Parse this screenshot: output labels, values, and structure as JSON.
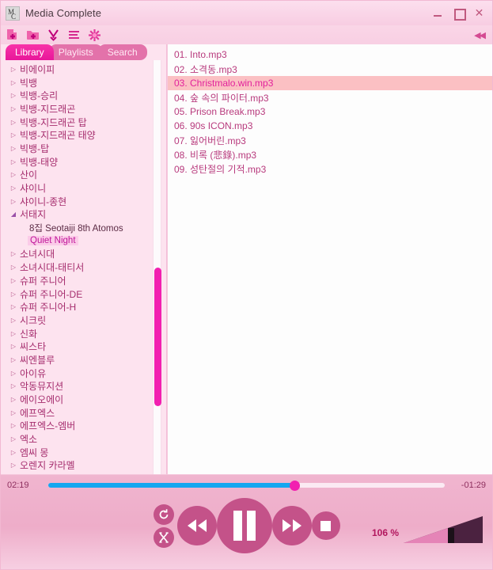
{
  "window": {
    "title": "Media Complete",
    "icon": "mc-logo-icon",
    "minimize_label": "",
    "maximize_label": "",
    "close_label": "✕"
  },
  "toolbar": {
    "icons": [
      {
        "name": "add-file-icon",
        "label": ""
      },
      {
        "name": "add-folder-icon",
        "label": ""
      },
      {
        "name": "import-download-icon",
        "label": ""
      },
      {
        "name": "playlist-lines-icon",
        "label": ""
      },
      {
        "name": "settings-star-icon",
        "label": ""
      }
    ],
    "collapse_label": "◀◀"
  },
  "tabs": [
    {
      "label": "Library",
      "active": true
    },
    {
      "label": "Playlists",
      "active": false
    },
    {
      "label": "Search",
      "active": false
    }
  ],
  "sidebar": {
    "items": [
      {
        "label": "비에이피",
        "type": "collapsed",
        "level": 0
      },
      {
        "label": "빅뱅",
        "type": "collapsed",
        "level": 0
      },
      {
        "label": "빅뱅-승리",
        "type": "collapsed",
        "level": 0
      },
      {
        "label": "빅뱅-지드래곤",
        "type": "collapsed",
        "level": 0
      },
      {
        "label": "빅뱅-지드래곤 탑",
        "type": "collapsed",
        "level": 0
      },
      {
        "label": "빅뱅-지드래곤 태양",
        "type": "collapsed",
        "level": 0
      },
      {
        "label": "빅뱅-탑",
        "type": "collapsed",
        "level": 0
      },
      {
        "label": "빅뱅-태양",
        "type": "collapsed",
        "level": 0
      },
      {
        "label": "산이",
        "type": "collapsed",
        "level": 0
      },
      {
        "label": "샤이니",
        "type": "collapsed",
        "level": 0
      },
      {
        "label": "샤이니-종현",
        "type": "collapsed",
        "level": 0
      },
      {
        "label": "서태지",
        "type": "expanded",
        "level": 0
      },
      {
        "label": "8집 Seotaiji 8th Atomos",
        "type": "child",
        "level": 1
      },
      {
        "label": "Quiet Night",
        "type": "child-selected",
        "level": 1
      },
      {
        "label": "소녀시대",
        "type": "collapsed",
        "level": 0
      },
      {
        "label": "소녀시대-태티서",
        "type": "collapsed",
        "level": 0
      },
      {
        "label": "슈퍼 주니어",
        "type": "collapsed",
        "level": 0
      },
      {
        "label": "슈퍼 주니어-DE",
        "type": "collapsed",
        "level": 0
      },
      {
        "label": "슈퍼 주니어-H",
        "type": "collapsed",
        "level": 0
      },
      {
        "label": "시크릿",
        "type": "collapsed",
        "level": 0
      },
      {
        "label": "신화",
        "type": "collapsed",
        "level": 0
      },
      {
        "label": "씨스타",
        "type": "collapsed",
        "level": 0
      },
      {
        "label": "씨엔블루",
        "type": "collapsed",
        "level": 0
      },
      {
        "label": "아이유",
        "type": "collapsed",
        "level": 0
      },
      {
        "label": "악동뮤지션",
        "type": "collapsed",
        "level": 0
      },
      {
        "label": "에이오에이",
        "type": "collapsed",
        "level": 0
      },
      {
        "label": "에프엑스",
        "type": "collapsed",
        "level": 0
      },
      {
        "label": "에프엑스-엠버",
        "type": "collapsed",
        "level": 0
      },
      {
        "label": "엑소",
        "type": "collapsed",
        "level": 0
      },
      {
        "label": "엠씨 몽",
        "type": "collapsed",
        "level": 0
      },
      {
        "label": "오렌지 카라멜",
        "type": "collapsed",
        "level": 0
      }
    ],
    "collapsed_arrow": "▷",
    "expanded_arrow": "◢"
  },
  "tracklist": [
    {
      "label": "01. Into.mp3",
      "selected": false
    },
    {
      "label": "02. 소격동.mp3",
      "selected": false
    },
    {
      "label": "03. Christmalo.win.mp3",
      "selected": true
    },
    {
      "label": "04. 숲 속의 파이터.mp3",
      "selected": false
    },
    {
      "label": "05. Prison Break.mp3",
      "selected": false
    },
    {
      "label": "06. 90s ICON.mp3",
      "selected": false
    },
    {
      "label": "07. 잃어버린.mp3",
      "selected": false
    },
    {
      "label": "08. 비록 (悲錄).mp3",
      "selected": false
    },
    {
      "label": "09. 성탄절의 기적.mp3",
      "selected": false
    }
  ],
  "player": {
    "elapsed": "02:19",
    "remaining": "-01:29",
    "progress_percent": 62,
    "repeat_label": "↻",
    "shuffle_label": "⤫",
    "rewind_label": "◀◀",
    "pause_label": "❚❚",
    "forward_label": "▶▶",
    "stop_label": "■",
    "volume_label": "106 %",
    "volume_percent": 56
  },
  "colors": {
    "accent": "#f21fb0",
    "button": "#c45289",
    "seek": "#15a7f0",
    "selection": "#fbc0c3",
    "background": "#fde3ef"
  }
}
